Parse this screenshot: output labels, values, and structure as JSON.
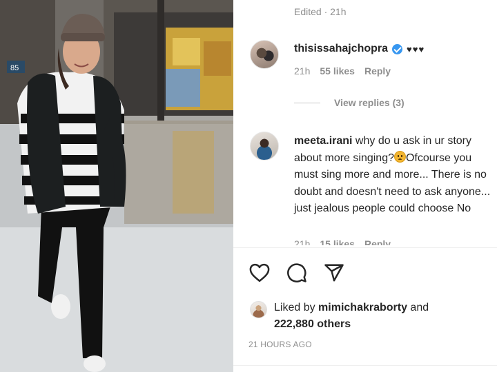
{
  "post": {
    "photo_alt": "woman in beanie and striped sweater walking on wet street",
    "sign_text": "85"
  },
  "comments": {
    "edited": "Edited · 21h",
    "c1": {
      "username": "thisissahajchopra",
      "text": "♥♥♥",
      "time": "21h",
      "likes": "55 likes",
      "reply": "Reply",
      "view_replies": "View replies (3)"
    },
    "c2": {
      "username": "meeta.irani",
      "text_before_emoji": " why do u ask in ur story about more singing?",
      "text_after_emoji": "Ofcourse you must sing more and more... There is no doubt and doesn't need to ask anyone... just jealous people could choose No",
      "time": "21h",
      "likes": "15 likes",
      "reply": "Reply"
    }
  },
  "actions": {
    "like_icon": "heart-icon",
    "comment_icon": "comment-icon",
    "share_icon": "share-icon"
  },
  "likes": {
    "prefix": "Liked by ",
    "user": "mimichakraborty",
    "and": " and",
    "others": "222,880 others"
  },
  "timestamp": "21 HOURS AGO",
  "colors": {
    "verified": "#3897f0",
    "muted": "#8e8e8e",
    "text": "#262626"
  }
}
